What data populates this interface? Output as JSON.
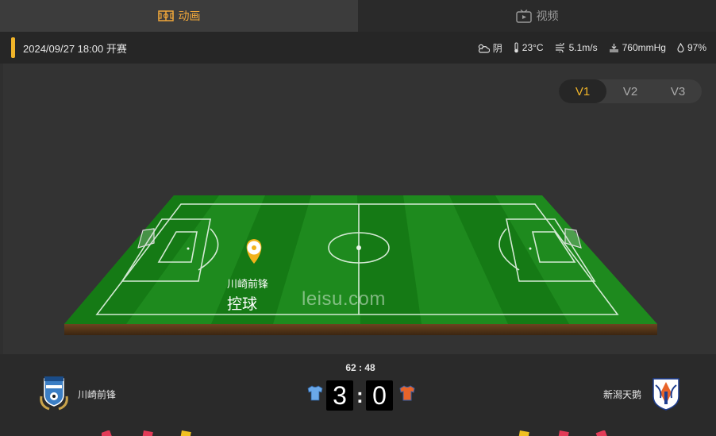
{
  "tabs": [
    {
      "label": "动画",
      "icon": "pitch-icon",
      "active": true
    },
    {
      "label": "视频",
      "icon": "tv-icon",
      "active": false
    }
  ],
  "match": {
    "datetime": "2024/09/27 18:00 开赛"
  },
  "weather": {
    "condition": "阴",
    "temperature": "23°C",
    "wind": "5.1m/s",
    "pressure": "760mmHg",
    "humidity": "97%"
  },
  "view_switch": {
    "options": [
      "V1",
      "V2",
      "V3"
    ],
    "selected": "V1"
  },
  "pitch": {
    "event_team": "川崎前锋",
    "event_action": "控球",
    "watermark": "leisu.com"
  },
  "scoreboard": {
    "clock": "62 : 48",
    "home_team": "川崎前锋",
    "away_team": "新潟天鹅",
    "home_score": "3",
    "separator": ":",
    "away_score": "0"
  },
  "colors": {
    "accent": "#f0b429",
    "home_shirt": "#6aa8e8",
    "away_shirt": "#e8642a",
    "pitch_green": "#1f8a1f"
  }
}
